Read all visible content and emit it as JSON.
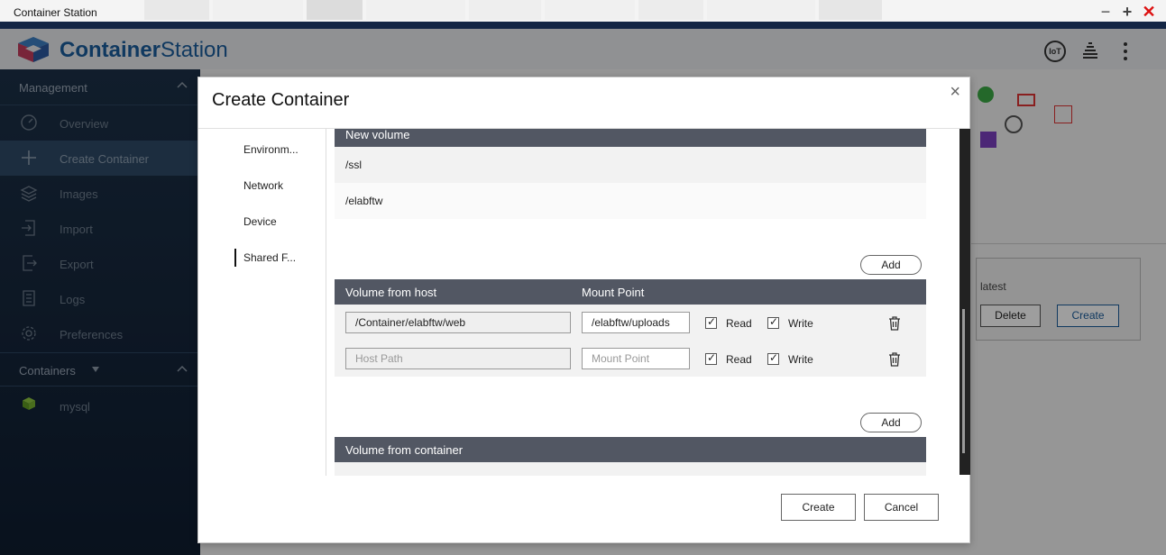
{
  "window": {
    "title": "Container Station"
  },
  "brand": {
    "part1": "Container",
    "part2": "Station"
  },
  "header_icons": {
    "iot": "IoT"
  },
  "sidebar": {
    "management_label": "Management",
    "items": [
      {
        "label": "Overview",
        "icon": "overview-icon"
      },
      {
        "label": "Create Container",
        "icon": "plus-icon"
      },
      {
        "label": "Images",
        "icon": "images-icon"
      },
      {
        "label": "Import",
        "icon": "import-icon"
      },
      {
        "label": "Export",
        "icon": "export-icon"
      },
      {
        "label": "Logs",
        "icon": "logs-icon"
      },
      {
        "label": "Preferences",
        "icon": "gear-icon"
      }
    ],
    "containers_label": "Containers",
    "containers": [
      {
        "label": "mysql",
        "icon": "cube-icon"
      }
    ]
  },
  "background_panel": {
    "tag": "latest",
    "delete_label": "Delete",
    "create_label": "Create"
  },
  "dialog": {
    "title": "Create Container",
    "close_glyph": "×",
    "nav": [
      "Environm...",
      "Network",
      "Device",
      "Shared F..."
    ],
    "new_volume": {
      "header": "New volume",
      "rows": [
        "/ssl",
        "/elabftw"
      ]
    },
    "add_label": "Add",
    "volume_from_host": {
      "header_host": "Volume from host",
      "header_mount": "Mount Point",
      "rows": [
        {
          "host": "/Container/elabftw/web",
          "mount": "/elabftw/uploads",
          "read": "Read",
          "write": "Write"
        }
      ],
      "empty_row": {
        "host_placeholder": "Host Path",
        "mount_placeholder": "Mount Point",
        "read": "Read",
        "write": "Write"
      }
    },
    "volume_from_container": {
      "header": "Volume from container"
    },
    "create_label": "Create",
    "cancel_label": "Cancel"
  },
  "colors": {
    "accent": "#1f3c6e",
    "brand": "#1b5c9c",
    "section_header": "#525763"
  }
}
